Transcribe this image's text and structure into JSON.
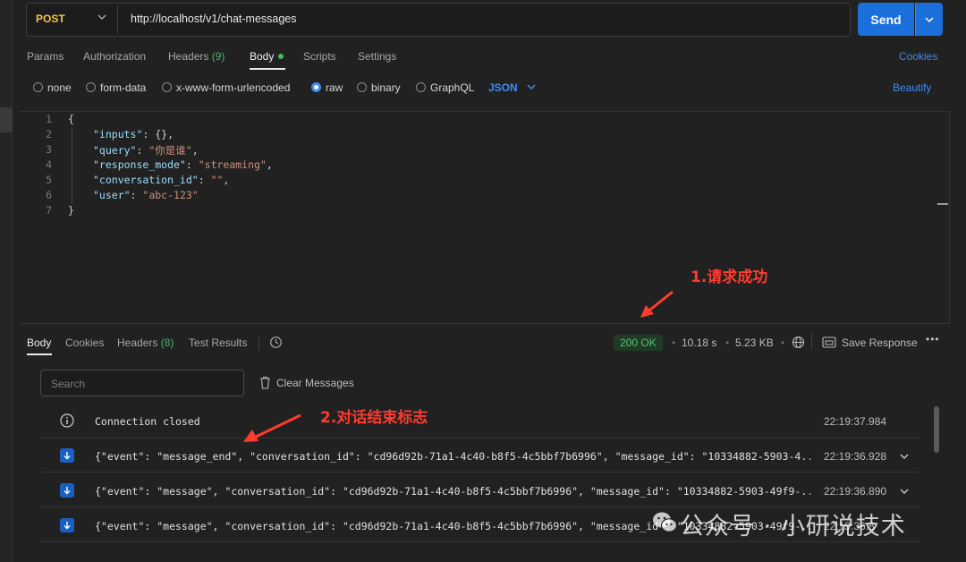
{
  "request": {
    "method": "POST",
    "url": "http://localhost/v1/chat-messages",
    "send_label": "Send"
  },
  "request_tabs": {
    "params": "Params",
    "authorization": "Authorization",
    "headers": "Headers",
    "headers_count": "(9)",
    "body": "Body",
    "scripts": "Scripts",
    "settings": "Settings",
    "cookies": "Cookies"
  },
  "body_types": {
    "none": "none",
    "form_data": "form-data",
    "urlencoded": "x-www-form-urlencoded",
    "raw": "raw",
    "binary": "binary",
    "graphql": "GraphQL",
    "selected": "raw",
    "language": "JSON",
    "beautify": "Beautify"
  },
  "editor": {
    "line_numbers": [
      "1",
      "2",
      "3",
      "4",
      "5",
      "6",
      "7"
    ],
    "open_brace": "{",
    "close_brace": "}",
    "fields": [
      {
        "key": "\"inputs\"",
        "sep": ": ",
        "value": "{}",
        "trail": ","
      },
      {
        "key": "\"query\"",
        "sep": ": ",
        "value": "\"你是谁\"",
        "trail": ","
      },
      {
        "key": "\"response_mode\"",
        "sep": ": ",
        "value": "\"streaming\"",
        "trail": ","
      },
      {
        "key": "\"conversation_id\"",
        "sep": ": ",
        "value": "\"\"",
        "trail": ","
      },
      {
        "key": "\"user\"",
        "sep": ": ",
        "value": "\"abc-123\"",
        "trail": ""
      }
    ]
  },
  "annotations": {
    "success": "1.请求成功",
    "end_flag": "2.对话结束标志"
  },
  "response": {
    "tabs": {
      "body": "Body",
      "cookies": "Cookies",
      "headers": "Headers",
      "headers_count": "(8)",
      "test_results": "Test Results"
    },
    "status": "200 OK",
    "time": "10.18 s",
    "size": "5.23 KB",
    "save_response": "Save Response",
    "search_placeholder": "Search",
    "clear_messages": "Clear Messages",
    "messages": [
      {
        "type": "info",
        "text": "Connection closed",
        "time": "22:19:37.984"
      },
      {
        "type": "down",
        "text": "{\"event\": \"message_end\", \"conversation_id\": \"cd96d92b-71a1-4c40-b8f5-4c5bbf7b6996\", \"message_id\": \"10334882-5903-4...",
        "time": "22:19:36.928"
      },
      {
        "type": "down",
        "text": "{\"event\": \"message\", \"conversation_id\": \"cd96d92b-71a1-4c40-b8f5-4c5bbf7b6996\", \"message_id\": \"10334882-5903-49f9-...",
        "time": "22:19:36.890"
      },
      {
        "type": "down",
        "text": "{\"event\": \"message\", \"conversation_id\": \"cd96d92b-71a1-4c40-b8f5-4c5bbf7b6996\", \"message_id\": \"10334882-5903-49f9-...",
        "time": "22:19:36.8"
      }
    ]
  },
  "watermark": "公众号 · 小研说技术",
  "colors": {
    "accent": "#1a6fdb",
    "method": "#f5c542",
    "status_ok": "#56c271",
    "annotation": "#ff3b30"
  }
}
